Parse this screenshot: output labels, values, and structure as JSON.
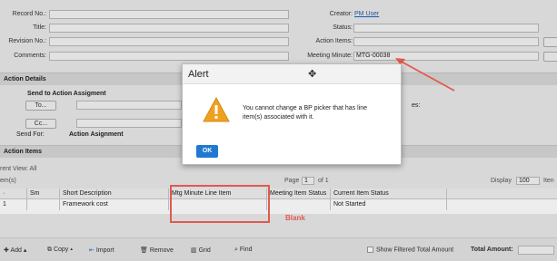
{
  "form": {
    "record_no_label": "Record No.:",
    "title_label": "Title:",
    "revision_no_label": "Revision No.:",
    "comments_label": "Comments:",
    "creator_label": "Creator:",
    "creator_value": "PM User",
    "status_label": "Status:",
    "action_items_label": "Action Items:",
    "meeting_minute_label": "Meeting Minute:",
    "meeting_minute_value": "MTG-00038"
  },
  "action_details": {
    "section_title": "Action Details",
    "send_to_title": "Send to Action Assigment",
    "to_button": "To...",
    "cc_button": "Cc...",
    "send_for_label": "Send For:",
    "send_for_value": "Action Asignment",
    "partial_label": "es:"
  },
  "action_items": {
    "section_title": "Action Items",
    "current_view": "rent View: All",
    "items_label": "em(s)",
    "pagination_prefix": "Page",
    "page_value": "1",
    "pagination_suffix": "of  1",
    "display_label": "Display",
    "display_value": "100",
    "display_suffix": "Iten",
    "columns": [
      "·",
      "Sm",
      "Short Description",
      "Mtg Minute Line Item",
      "Meeting Item Status",
      "Current Item Status"
    ],
    "rows": [
      {
        "no": "1",
        "sm": "",
        "description": "Framework cost",
        "mtg_line": "",
        "meeting_status": "",
        "current_status": "Not Started"
      }
    ]
  },
  "toolbar": {
    "add": "Add",
    "copy": "Copy",
    "import": "Import",
    "remove": "Remove",
    "grid": "Grid",
    "find": "Find",
    "show_filtered": "Show Filtered Total Amount",
    "total_amount": "Total Amount:"
  },
  "annotation": {
    "blank_label": "Blank",
    "color": "#e05a4e"
  },
  "dialog": {
    "title": "Alert",
    "message": "You cannot change a BP picker that has line item(s) associated with it.",
    "ok_button": "OK"
  },
  "colors": {
    "ok_button": "#1f78d1",
    "warning": "#f0a020",
    "link": "#1f5fb5"
  }
}
